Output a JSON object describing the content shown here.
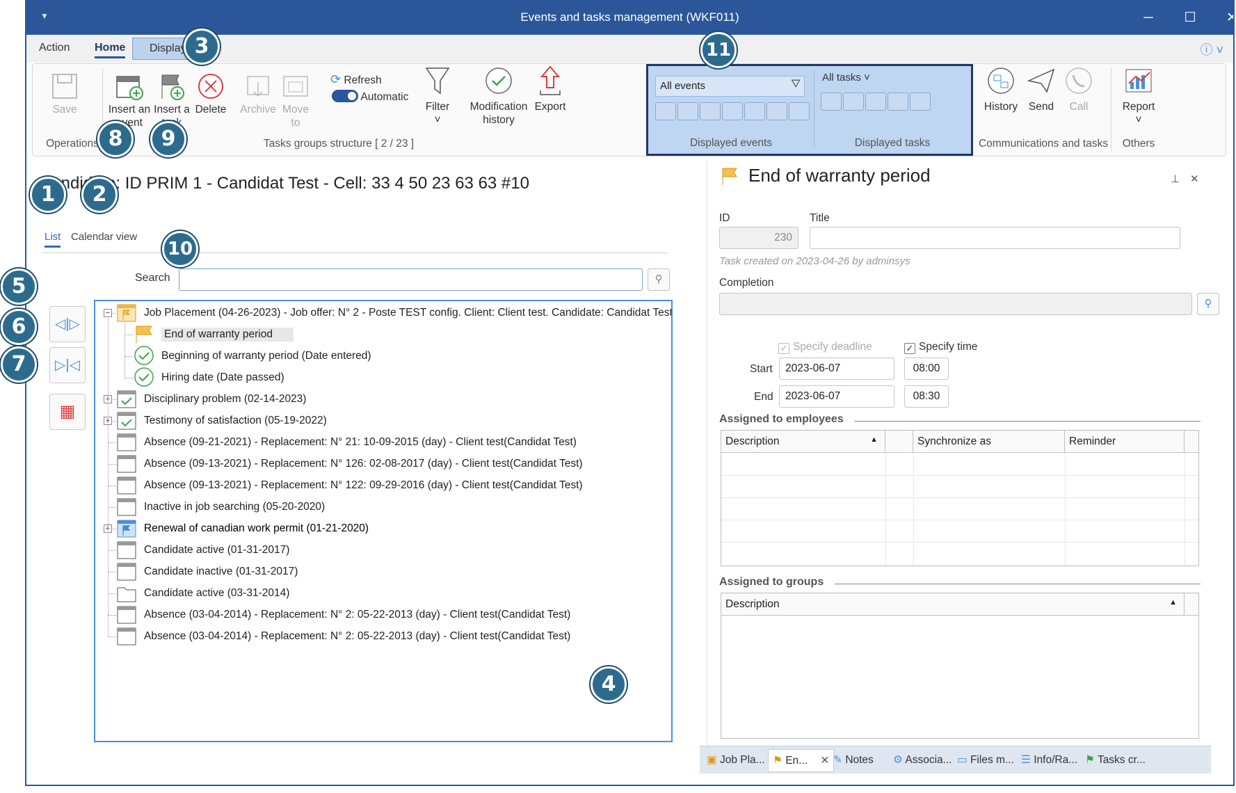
{
  "window": {
    "title": "Events and tasks management (WKF011)"
  },
  "menu": {
    "action": "Action",
    "home": "Home",
    "display": "Display"
  },
  "ribbon": {
    "save": "Save",
    "insert_event": "Insert an event",
    "insert_task": "Insert a task",
    "delete": "Delete",
    "archive": "Archive",
    "move_to": "Move to",
    "refresh": "Refresh",
    "automatic": "Automatic",
    "filter": "Filter",
    "mod_history": "Modification history",
    "export": "Export",
    "events_select": "All events",
    "tasks_select": "All tasks",
    "history": "History",
    "send": "Send",
    "call": "Call",
    "report": "Report",
    "group_operations": "Operations",
    "group_tasks_structure": "Tasks groups structure [ 2 / 23 ]",
    "group_displayed_events": "Displayed events",
    "group_displayed_tasks": "Displayed tasks",
    "group_comm": "Communications and tasks",
    "group_others": "Others"
  },
  "left": {
    "title": "Candidate: ID PRIM 1 - Candidat Test - Cell: 33 4 50 23 63 63 #10",
    "tab_list": "List",
    "tab_calendar": "Calendar view",
    "search_label": "Search",
    "search_value": "",
    "tree": [
      {
        "text": "Job Placement (04-26-2023) - Job offer: N° 2 - Poste TEST config.  Client: Client test.  Candidate: Candidat Test",
        "icon": "event-orange-icon",
        "level": 0,
        "expander": "minus"
      },
      {
        "text": "End of warranty period",
        "icon": "flag-orange-icon",
        "level": 1,
        "selected": true
      },
      {
        "text": "Beginning of warranty period (Date entered)",
        "icon": "check-circle-icon",
        "level": 1
      },
      {
        "text": "Hiring date (Date passed)",
        "icon": "check-circle-icon",
        "level": 1
      },
      {
        "text": "Disciplinary problem (02-14-2023)",
        "icon": "calendar-check-icon",
        "level": 0,
        "expander": "plus"
      },
      {
        "text": "Testimony of satisfaction (05-19-2022)",
        "icon": "calendar-check-icon",
        "level": 0,
        "expander": "plus"
      },
      {
        "text": "Absence (09-21-2021) - Replacement: N° 21: 10-09-2015 (day) - Client test(Candidat Test)",
        "icon": "calendar-icon",
        "level": 0
      },
      {
        "text": "Absence (09-13-2021) - Replacement: N° 126: 02-08-2017 (day) - Client test(Candidat Test)",
        "icon": "calendar-icon",
        "level": 0
      },
      {
        "text": "Absence (09-13-2021) - Replacement: N° 122: 09-29-2016 (day) - Client test(Candidat Test)",
        "icon": "calendar-icon",
        "level": 0
      },
      {
        "text": "Inactive in job searching (05-20-2020)",
        "icon": "calendar-icon",
        "level": 0
      },
      {
        "text": "Renewal of canadian work permit (01-21-2020)",
        "icon": "event-blue-icon",
        "level": 0,
        "expander": "plus",
        "emph": true
      },
      {
        "text": "Candidate active (01-31-2017)",
        "icon": "calendar-icon",
        "level": 0
      },
      {
        "text": "Candidate inactive (01-31-2017)",
        "icon": "calendar-icon",
        "level": 0
      },
      {
        "text": "Candidate active (03-31-2014)",
        "icon": "folder-icon",
        "level": 0
      },
      {
        "text": "Absence (03-04-2014) - Replacement: N° 2: 05-22-2013 (day) - Client test(Candidat Test)",
        "icon": "calendar-icon",
        "level": 0
      },
      {
        "text": "Absence (03-04-2014) - Replacement: N° 2: 05-22-2013 (day) - Client test(Candidat Test)",
        "icon": "calendar-icon",
        "level": 0
      }
    ]
  },
  "right": {
    "header": "End of warranty period",
    "id_label": "ID",
    "id_value": "230",
    "title_label": "Title",
    "title_value": "",
    "created": "Task created on 2023-04-26 by adminsys",
    "completion_label": "Completion",
    "completion_value": "",
    "specify_deadline": "Specify deadline",
    "specify_time": "Specify time",
    "start_label": "Start",
    "start_date": "2023-06-07",
    "start_time": "08:00",
    "end_label": "End",
    "end_date": "2023-06-07",
    "end_time": "08:30",
    "employees_section": "Assigned to employees",
    "employees_cols": [
      "Description",
      "",
      "Synchronize as",
      "Reminder"
    ],
    "groups_section": "Assigned to groups",
    "groups_cols": [
      "Description"
    ]
  },
  "bottom_tabs": [
    "Job Pla...",
    "En...",
    "Notes",
    "Associa...",
    "Files m...",
    "Info/Ra...",
    "Tasks cr..."
  ],
  "badges": [
    "1",
    "2",
    "3",
    "4",
    "5",
    "6",
    "7",
    "8",
    "9",
    "10",
    "11"
  ],
  "colors": {
    "titlebar": "#2b579a",
    "accent": "#2b6cc4",
    "badge": "#2d6b8e"
  }
}
